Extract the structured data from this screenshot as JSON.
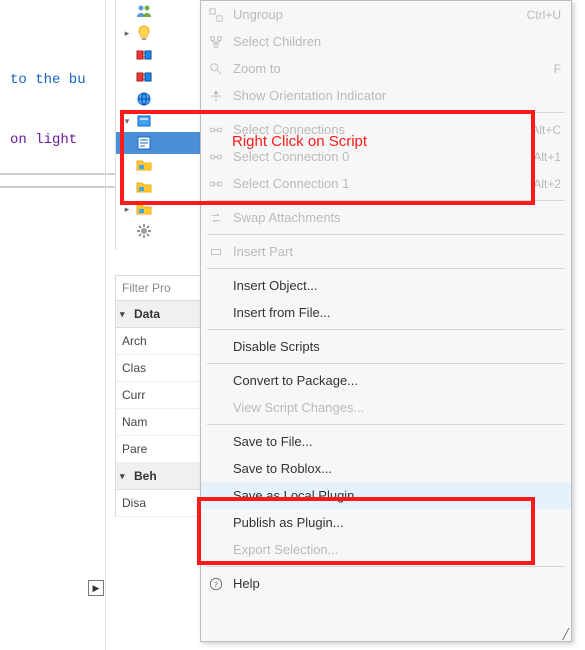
{
  "code": {
    "line1a": "to the bu",
    "line2a": "on light "
  },
  "tree": {
    "rows": [
      {
        "chev": "",
        "icon": "people",
        "selected": false
      },
      {
        "chev": ">",
        "icon": "bulb",
        "selected": false
      },
      {
        "chev": "",
        "icon": "part-red",
        "selected": false
      },
      {
        "chev": "",
        "icon": "part-red",
        "selected": false
      },
      {
        "chev": "",
        "icon": "globe",
        "selected": false
      },
      {
        "chev": "v",
        "icon": "part-blue",
        "selected": false
      },
      {
        "chev": "",
        "icon": "script",
        "selected": true
      },
      {
        "chev": "",
        "icon": "folder",
        "selected": false
      },
      {
        "chev": "",
        "icon": "folder",
        "selected": false
      },
      {
        "chev": ">",
        "icon": "folder",
        "selected": false
      },
      {
        "chev": "",
        "icon": "cog",
        "selected": false
      }
    ]
  },
  "properties": {
    "filter_placeholder": "Filter Pro",
    "sections": [
      {
        "name": "Data",
        "rows": [
          "Arch",
          "Clas",
          "Curr",
          "Nam",
          "Pare"
        ]
      },
      {
        "name": "Beh",
        "rows": [
          "Disa"
        ]
      }
    ]
  },
  "menu": {
    "groups": [
      {
        "items": [
          {
            "label": "Ungroup",
            "shortcut": "Ctrl+U",
            "disabled": true,
            "icon": "ungroup"
          },
          {
            "label": "Select Children",
            "shortcut": "",
            "disabled": true,
            "icon": "children"
          },
          {
            "label": "Zoom to",
            "shortcut": "F",
            "disabled": true,
            "icon": "zoom"
          },
          {
            "label": "Show Orientation Indicator",
            "shortcut": "",
            "disabled": true,
            "icon": "orient"
          }
        ]
      },
      {
        "items": [
          {
            "label": "Select Connections",
            "shortcut": "Alt+C",
            "disabled": true,
            "icon": "conn"
          },
          {
            "label": "Select Connection 0",
            "shortcut": "Alt+1",
            "disabled": true,
            "icon": "conn"
          },
          {
            "label": "Select Connection 1",
            "shortcut": "Alt+2",
            "disabled": true,
            "icon": "conn"
          }
        ]
      },
      {
        "items": [
          {
            "label": "Swap Attachments",
            "shortcut": "",
            "disabled": true,
            "icon": "swap"
          }
        ]
      },
      {
        "items": [
          {
            "label": "Insert Part",
            "shortcut": "",
            "disabled": true,
            "icon": "insertpart"
          }
        ]
      },
      {
        "items": [
          {
            "label": "Insert Object...",
            "shortcut": "",
            "disabled": false,
            "icon": ""
          },
          {
            "label": "Insert from File...",
            "shortcut": "",
            "disabled": false,
            "icon": ""
          }
        ]
      },
      {
        "items": [
          {
            "label": "Disable Scripts",
            "shortcut": "",
            "disabled": false,
            "icon": ""
          }
        ]
      },
      {
        "items": [
          {
            "label": "Convert to Package...",
            "shortcut": "",
            "disabled": false,
            "icon": ""
          },
          {
            "label": "View Script Changes...",
            "shortcut": "",
            "disabled": true,
            "icon": ""
          }
        ]
      },
      {
        "items": [
          {
            "label": "Save to File...",
            "shortcut": "",
            "disabled": false,
            "icon": ""
          },
          {
            "label": "Save to Roblox...",
            "shortcut": "",
            "disabled": false,
            "icon": ""
          },
          {
            "label": "Save as Local Plugin...",
            "shortcut": "",
            "disabled": false,
            "icon": "",
            "hover": true
          },
          {
            "label": "Publish as Plugin...",
            "shortcut": "",
            "disabled": false,
            "icon": ""
          },
          {
            "label": "Export Selection...",
            "shortcut": "",
            "disabled": true,
            "icon": ""
          }
        ]
      },
      {
        "items": [
          {
            "label": "Help",
            "shortcut": "",
            "disabled": false,
            "icon": "help"
          }
        ]
      }
    ]
  },
  "annotations": {
    "box1": {},
    "box2": {},
    "label1": "Right Click on Script"
  }
}
